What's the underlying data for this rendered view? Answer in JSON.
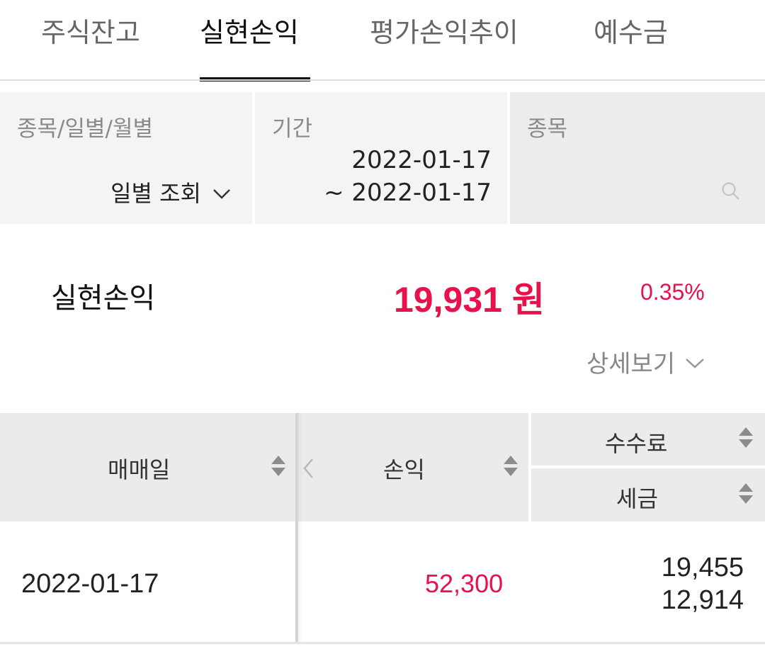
{
  "tabs": [
    {
      "label": "주식잔고",
      "active": false
    },
    {
      "label": "실현손익",
      "active": true
    },
    {
      "label": "평가손익추이",
      "active": false
    },
    {
      "label": "예수금",
      "active": false
    }
  ],
  "filters": {
    "type_caption": "종목/일별/월별",
    "type_value": "일별 조회",
    "period_caption": "기간",
    "period_start": "2022-01-17",
    "period_end": "~ 2022-01-17",
    "stock_caption": "종목"
  },
  "summary": {
    "label": "실현손익",
    "amount": "19,931 원",
    "rate": "0.35%",
    "detail_label": "상세보기"
  },
  "table": {
    "headers": {
      "date": "매매일",
      "profit_loss": "손익",
      "fee": "수수료",
      "tax": "세금"
    },
    "rows": [
      {
        "date": "2022-01-17",
        "profit_loss": "52,300",
        "fee": "19,455",
        "tax": "12,914"
      }
    ]
  },
  "colors": {
    "accent_red": "#e8114b",
    "active_tab": "#111111",
    "inactive_tab": "#666666",
    "header_bg": "#ebebeb",
    "filter_bg": "#f4f4f4"
  }
}
